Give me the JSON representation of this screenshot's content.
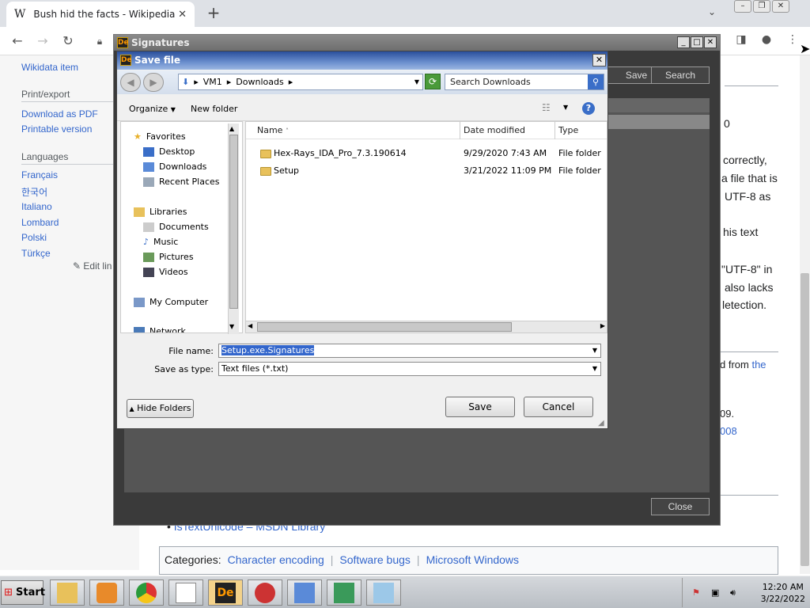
{
  "browser": {
    "tab_title": "Bush hid the facts - Wikipedia",
    "tab_logo": "W",
    "newtab_symbol": "+",
    "tabs_dropdown": "⌄"
  },
  "wikipedia": {
    "sidebar": {
      "wikidata": "Wikidata item",
      "print_export_heading": "Print/export",
      "download_pdf": "Download as PDF",
      "printable": "Printable version",
      "languages_heading": "Languages",
      "languages": [
        "Français",
        "한국어",
        "Italiano",
        "Lombard",
        "Polski",
        "Türkçe"
      ],
      "edit_links": "Edit lin"
    },
    "body_fragments": [
      "0",
      "correctly,",
      "a file that is",
      "UTF-8 as",
      "his text",
      "\"UTF-8\" in",
      "also lacks",
      "letection.",
      "d from",
      "the",
      "09.",
      "008",
      "IsTextUnicode",
      "– MSDN Library"
    ],
    "categories_label": "Categories:",
    "categories": [
      "Character encoding",
      "Software bugs",
      "Microsoft Windows"
    ]
  },
  "signatures_window": {
    "title": "Signatures",
    "save_label": "Save",
    "search_label": "Search",
    "close_label": "Close",
    "controls": [
      "_",
      "□",
      "✕"
    ]
  },
  "save_dialog": {
    "title": "Save file",
    "breadcrumb": [
      "VM1",
      "Downloads"
    ],
    "search_placeholder": "Search Downloads",
    "organize_label": "Organize",
    "new_folder_label": "New folder",
    "help_symbol": "?",
    "nav": {
      "favorites_heading": "Favorites",
      "favorites": [
        "Desktop",
        "Downloads",
        "Recent Places"
      ],
      "libraries_heading": "Libraries",
      "libraries": [
        "Documents",
        "Music",
        "Pictures",
        "Videos"
      ],
      "computer": "My Computer",
      "network": "Network"
    },
    "columns": [
      "Name",
      "Date modified",
      "Type"
    ],
    "files": [
      {
        "name": "Hex-Rays_IDA_Pro_7.3.190614",
        "date": "9/29/2020 7:43 AM",
        "type": "File folder"
      },
      {
        "name": "Setup",
        "date": "3/21/2022 11:09 PM",
        "type": "File folder"
      }
    ],
    "file_name_label": "File name:",
    "file_name_value": "Setup.exe.Signatures",
    "save_type_label": "Save as type:",
    "save_type_value": "Text files (*.txt)",
    "hide_folders_label": "Hide Folders",
    "save_button": "Save",
    "cancel_button": "Cancel"
  },
  "taskbar": {
    "start_label": "Start",
    "clock_time": "12:20 AM",
    "clock_date": "3/22/2022"
  },
  "colors": {
    "wiki_link": "#3366cc",
    "dialog_title_start": "#2a4f9c",
    "signatures_bg": "#3a3a3a"
  }
}
